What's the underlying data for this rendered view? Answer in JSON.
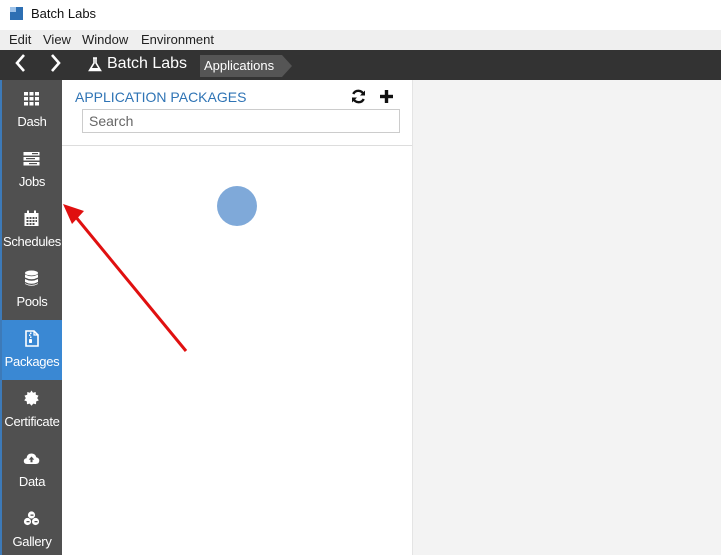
{
  "window": {
    "title": "Batch Labs",
    "app_icon": "app-window-icon"
  },
  "menubar": {
    "items": [
      "Edit",
      "View",
      "Window",
      "Environment"
    ]
  },
  "topnav": {
    "back_icon": "chevron-left-icon",
    "forward_icon": "chevron-right-icon",
    "brand_icon": "flask-icon",
    "brand": "Batch Labs",
    "breadcrumb": "Applications"
  },
  "sidebar": {
    "items": [
      {
        "label": "Dash",
        "icon": "dashboard-grid-icon",
        "active": false
      },
      {
        "label": "Jobs",
        "icon": "tasks-list-icon",
        "active": false
      },
      {
        "label": "Schedules",
        "icon": "calendar-icon",
        "active": false
      },
      {
        "label": "Pools",
        "icon": "database-icon",
        "active": false
      },
      {
        "label": "Packages",
        "icon": "file-archive-icon",
        "active": true
      },
      {
        "label": "Certificate",
        "icon": "certificate-icon",
        "active": false
      },
      {
        "label": "Data",
        "icon": "cloud-upload-icon",
        "active": false
      },
      {
        "label": "Gallery",
        "icon": "cubes-icon",
        "active": false
      }
    ]
  },
  "panel": {
    "title": "APPLICATION PACKAGES",
    "refresh_icon": "refresh-icon",
    "add_icon": "plus-icon",
    "search": {
      "placeholder": "Search",
      "value": ""
    },
    "loading": true
  },
  "colors": {
    "accent": "#3a88d3",
    "title_blue": "#2f74b5",
    "sidebar_bg": "#505050",
    "topnav_bg": "#333333",
    "spinner": "#7fa9d9",
    "annotation_arrow": "#e01010"
  }
}
